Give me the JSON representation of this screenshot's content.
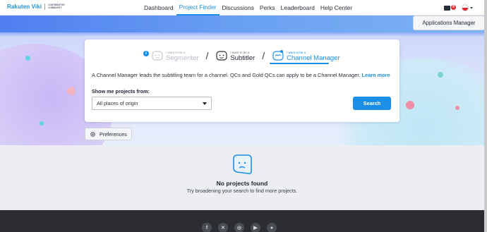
{
  "brand": {
    "logo_main": "Rakuten Viki",
    "logo_sub": "CONTRIBUTOR COMMUNITY"
  },
  "nav": {
    "items": [
      {
        "label": "Dashboard",
        "active": false
      },
      {
        "label": "Project Finder",
        "active": true
      },
      {
        "label": "Discussions",
        "active": false
      },
      {
        "label": "Perks",
        "active": false
      },
      {
        "label": "Leaderboard",
        "active": false
      },
      {
        "label": "Help Center",
        "active": false
      }
    ],
    "mail_badge": "8"
  },
  "hero": {
    "apps_button": "Applications Manager"
  },
  "roles": {
    "prefix": "I want to be a",
    "items": [
      {
        "name": "Segmenter",
        "state": "disabled"
      },
      {
        "name": "Subtitler",
        "state": "available"
      },
      {
        "name": "Channel Manager",
        "state": "selected"
      }
    ]
  },
  "card": {
    "description": "A Channel Manager leads the subtitling team for a channel. QCs and Gold QCs can apply to be a Channel Manager.",
    "learn_more": "Learn more",
    "show_label": "Show me projects from:",
    "select_value": "All places of origin",
    "search_button": "Search"
  },
  "preferences_button": "Preferences",
  "empty": {
    "title": "No projects found",
    "subtitle": "Try broadening your search to find more projects."
  },
  "footer": {
    "social_icons": [
      "facebook-icon",
      "x-icon",
      "instagram-icon",
      "youtube-icon",
      "chat-icon"
    ]
  },
  "colors": {
    "accent": "#1b8fe6",
    "footer_bg": "#2b2d31",
    "empty_bg": "#eceef1",
    "badge": "#e0282e"
  }
}
